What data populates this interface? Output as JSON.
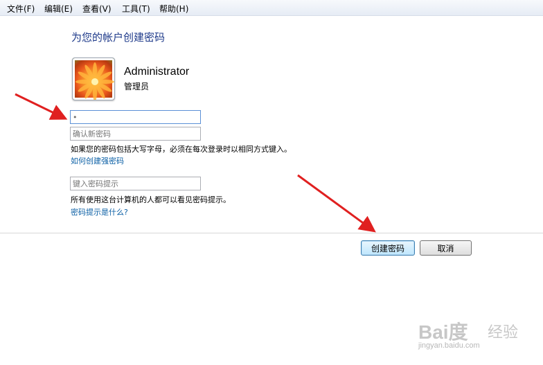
{
  "menubar": {
    "items": [
      {
        "label": "文件(F)"
      },
      {
        "label": "编辑(E)"
      },
      {
        "label": "查看(V)"
      },
      {
        "label": "工具(T)"
      },
      {
        "label": "帮助(H)"
      }
    ]
  },
  "page": {
    "title": "为您的帐户创建密码",
    "username": "Administrator",
    "role": "管理员"
  },
  "form": {
    "new_password_value": "•",
    "confirm_placeholder": "确认新密码",
    "caps_notice": "如果您的密码包括大写字母，必须在每次登录时以相同方式键入。",
    "strong_password_link": "如何创建强密码",
    "hint_placeholder": "键入密码提示",
    "hint_notice": "所有使用这台计算机的人都可以看见密码提示。",
    "hint_link": "密码提示是什么?"
  },
  "buttons": {
    "create_label": "创建密码",
    "cancel_label": "取消"
  },
  "annotations": {
    "arrow_color": "#e02020"
  },
  "watermark": {
    "logo": "Bai度",
    "logo_suffix": "经验",
    "url": "jingyan.baidu.com"
  }
}
